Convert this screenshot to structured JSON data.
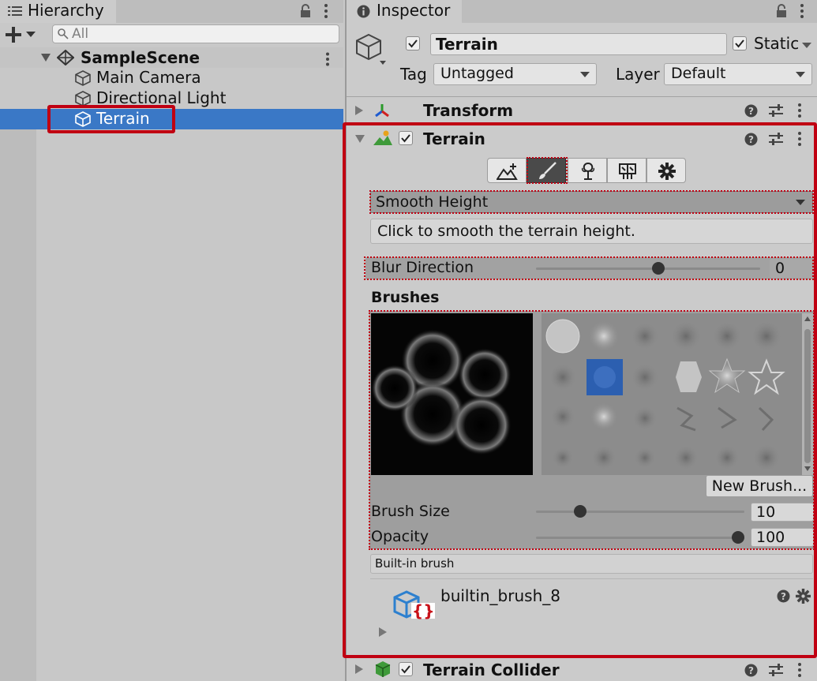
{
  "hierarchy": {
    "tab_label": "Hierarchy",
    "search_placeholder": "All",
    "scene_name": "SampleScene",
    "items": [
      {
        "label": "Main Camera"
      },
      {
        "label": "Directional Light"
      },
      {
        "label": "Terrain"
      }
    ]
  },
  "inspector": {
    "tab_label": "Inspector",
    "object_name": "Terrain",
    "static_label": "Static",
    "tag_label": "Tag",
    "tag_value": "Untagged",
    "layer_label": "Layer",
    "layer_value": "Default",
    "components": {
      "transform": "Transform",
      "terrain": "Terrain",
      "terrain_collider": "Terrain Collider"
    },
    "terrain": {
      "tool_value": "Smooth Height",
      "help_text": "Click to smooth the terrain height.",
      "blur_label": "Blur Direction",
      "blur_value": "0",
      "brushes_label": "Brushes",
      "new_brush_label": "New Brush...",
      "brush_size_label": "Brush Size",
      "brush_size_value": "10",
      "opacity_label": "Opacity",
      "opacity_value": "100",
      "builtin_label": "Built-in brush",
      "brush_asset_name": "builtin_brush_8",
      "brush_asset_badge": "{}"
    }
  },
  "colors": {
    "highlight_red": "#c00012",
    "selection_blue": "#3a78c6",
    "panel_bg": "#c8c8c8"
  }
}
